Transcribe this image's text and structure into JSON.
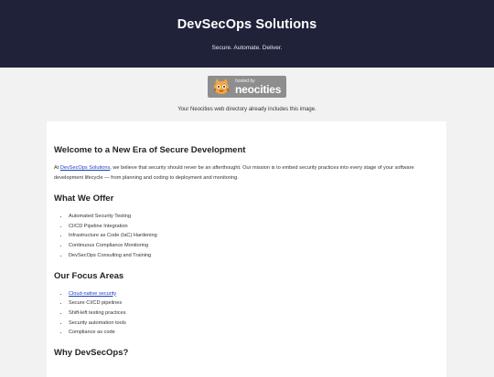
{
  "header": {
    "title": "DevSecOps Solutions",
    "tagline": "Secure. Automate. Deliver."
  },
  "badge": {
    "small_text": "hosted by",
    "big_text": "neocities",
    "note": "Your Neocities web directory already includes this image."
  },
  "content": {
    "welcome_heading": "Welcome to a New Era of Secure Development",
    "intro_prefix": "At ",
    "intro_link": "DevSecOps Solutions",
    "intro_suffix": ", we believe that security should never be an afterthought. Our mission is to embed security practices into every stage of your software development lifecycle — from planning and coding to deployment and monitoring.",
    "offer_heading": "What We Offer",
    "offer_items": [
      "Automated Security Testing",
      "CI/CD Pipeline Integration",
      "Infrastructure as Code (IaC) Hardening",
      "Continuous Compliance Monitoring",
      "DevSecOps Consulting and Training"
    ],
    "focus_heading": "Our Focus Areas",
    "focus_link": "Cloud-native security",
    "focus_items": [
      "Secure CI/CD pipelines",
      "Shift-left testing practices",
      "Security automation tools",
      "Compliance as code"
    ],
    "why_heading": "Why DevSecOps?"
  },
  "colors": {
    "header_bg": "#20223a",
    "page_bg": "#f2f2f2",
    "link": "#1a3ec4"
  }
}
